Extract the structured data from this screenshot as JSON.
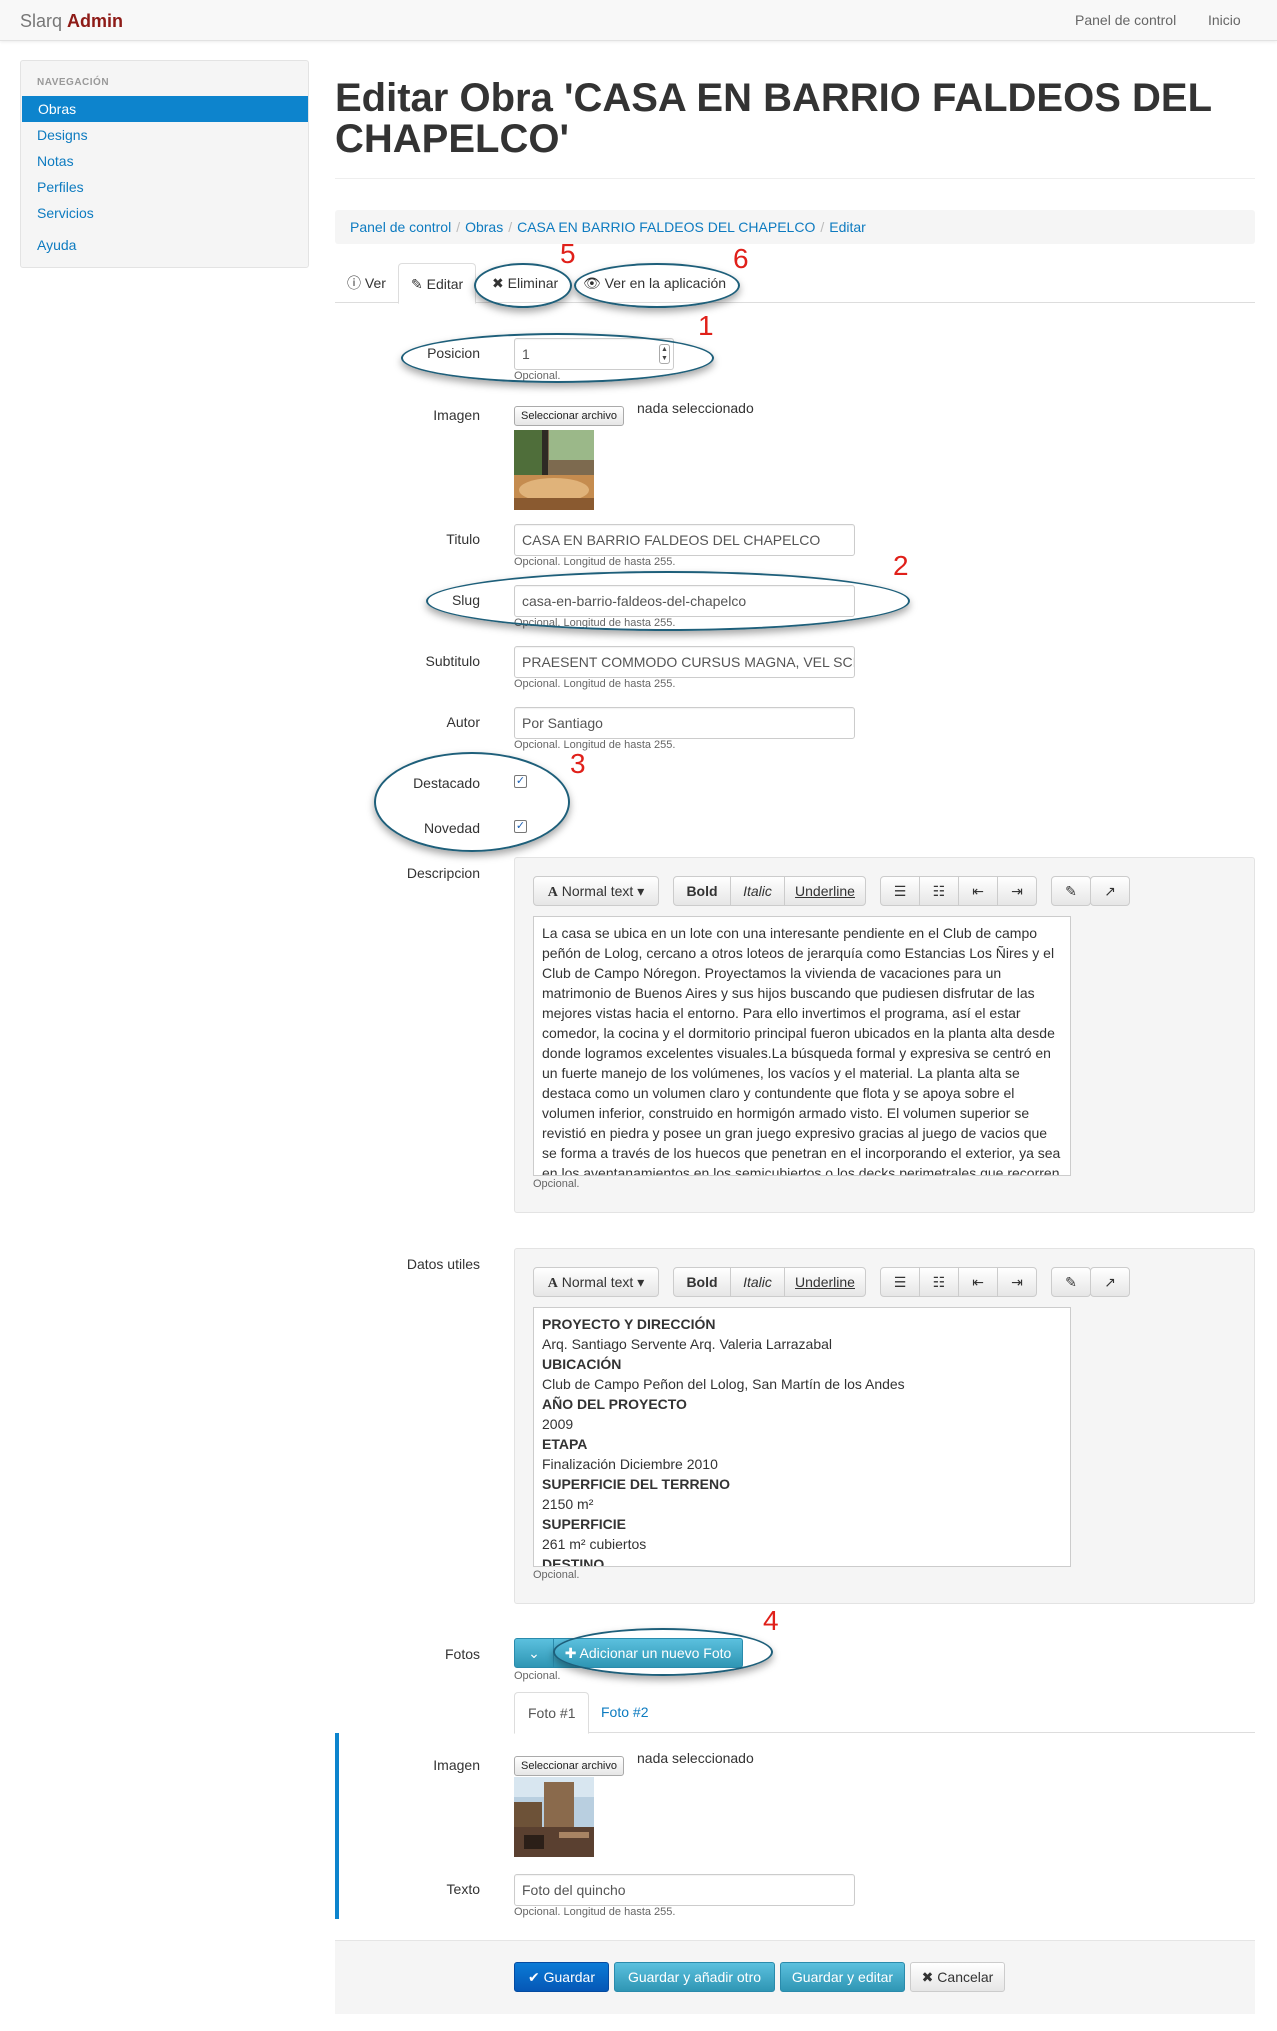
{
  "navbar": {
    "brand_prefix": "Slarq",
    "brand_suffix": "Admin",
    "links": [
      "Panel de control",
      "Inicio"
    ]
  },
  "sidebar": {
    "header": "NAVEGACIÓN",
    "items": [
      "Obras",
      "Designs",
      "Notas",
      "Perfiles",
      "Servicios",
      "Ayuda"
    ],
    "active": "Obras"
  },
  "page": {
    "title": "Editar Obra 'CASA EN BARRIO FALDEOS DEL CHAPELCO'"
  },
  "breadcrumb": [
    "Panel de control",
    "Obras",
    "CASA EN BARRIO FALDEOS DEL CHAPELCO",
    "Editar"
  ],
  "tabs": {
    "ver": "Ver",
    "editar": "Editar",
    "eliminar": "Eliminar",
    "ver_app": "Ver en la aplicación"
  },
  "form": {
    "posicion": {
      "label": "Posicion",
      "value": "1",
      "help": "Opcional."
    },
    "imagen": {
      "label": "Imagen",
      "button": "Seleccionar archivo",
      "status": "nada seleccionado"
    },
    "titulo": {
      "label": "Titulo",
      "value": "CASA EN BARRIO FALDEOS DEL CHAPELCO",
      "help": "Opcional. Longitud de hasta 255."
    },
    "slug": {
      "label": "Slug",
      "value": "casa-en-barrio-faldeos-del-chapelco",
      "help": "Opcional. Longitud de hasta 255."
    },
    "subtitulo": {
      "label": "Subtitulo",
      "value": "PRAESENT COMMODO CURSUS MAGNA, VEL SCI",
      "help": "Opcional. Longitud de hasta 255."
    },
    "autor": {
      "label": "Autor",
      "value": "Por Santiago",
      "help": "Opcional. Longitud de hasta 255."
    },
    "destacado": {
      "label": "Destacado",
      "checked": true
    },
    "novedad": {
      "label": "Novedad",
      "checked": true
    },
    "descripcion": {
      "label": "Descripcion",
      "help": "Opcional.",
      "lines": [
        "La casa se ubica en un lote con una interesante pendiente en el Club de campo",
        "peñón de Lolog, cercano a otros loteos de jerarquía como Estancias Los Ñires y el",
        "Club de Campo Nóregon. Proyectamos la vivienda de vacaciones para un",
        "matrimonio de Buenos Aires y sus hijos buscando que pudiesen disfrutar de las",
        "mejores vistas hacia el entorno. Para ello invertimos el programa, así el estar",
        "comedor, la cocina y el dormitorio principal fueron ubicados en la planta alta desde",
        "donde logramos excelentes visuales.La búsqueda formal y expresiva se centró en",
        "un fuerte manejo de los volúmenes, los vacíos y el material. La planta alta se",
        "destaca como un volumen claro y contundente que flota y se apoya sobre el",
        "volumen inferior, construido en hormigón armado visto. El volumen superior se",
        "revistió en piedra y posee un gran juego expresivo gracias al juego de vacios que",
        "se forma a través de los huecos que penetran en el incorporando el exterior, ya sea",
        "en los aventanamientos en los semicubiertos o los decks perimetrales que recorren"
      ]
    },
    "datos": {
      "label": "Datos utiles",
      "help": "Opcional.",
      "lines": [
        {
          "t": "PROYECTO Y DIRECCIÓN",
          "b": true
        },
        {
          "t": "Arq. Santiago Servente Arq. Valeria Larrazabal",
          "b": false
        },
        {
          "t": "UBICACIÓN",
          "b": true
        },
        {
          "t": "Club de Campo Peñon del Lolog, San Martín de los Andes",
          "b": false
        },
        {
          "t": "AÑO DEL PROYECTO",
          "b": true
        },
        {
          "t": "2009",
          "b": false
        },
        {
          "t": "ETAPA",
          "b": true
        },
        {
          "t": "Finalización Diciembre 2010",
          "b": false
        },
        {
          "t": "SUPERFICIE DEL TERRENO",
          "b": true
        },
        {
          "t": "2150 m²",
          "b": false
        },
        {
          "t": "SUPERFICIE",
          "b": true
        },
        {
          "t": "261 m² cubiertos",
          "b": false
        },
        {
          "t": "DESTINO",
          "b": true
        }
      ]
    },
    "fotos": {
      "label": "Fotos",
      "add_button": "Adicionar un nuevo Foto",
      "help": "Opcional.",
      "tabs": [
        "Foto #1",
        "Foto #2"
      ],
      "foto1": {
        "imagen_label": "Imagen",
        "button": "Seleccionar archivo",
        "status": "nada seleccionado",
        "texto_label": "Texto",
        "texto_value": "Foto del quincho",
        "help": "Opcional. Longitud de hasta 255."
      }
    }
  },
  "toolbar": {
    "normal_text": "Normal text",
    "bold": "Bold",
    "italic": "Italic",
    "underline": "Underline"
  },
  "actions": {
    "guardar": "Guardar",
    "guardar_otro": "Guardar y añadir otro",
    "guardar_editar": "Guardar y editar",
    "cancelar": "Cancelar"
  },
  "annotations": [
    "1",
    "2",
    "3",
    "4",
    "5",
    "6"
  ],
  "colors": {
    "primary": "#0d84cd",
    "brand": "#8e1b17",
    "annotation": "#e0201a",
    "oval": "#1e5f7a",
    "info": "#5bc0de"
  }
}
